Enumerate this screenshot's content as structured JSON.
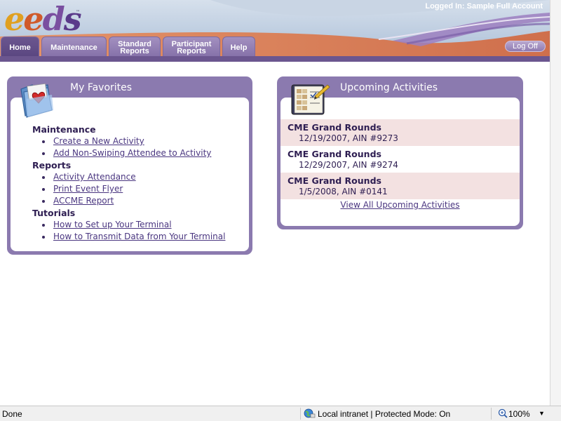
{
  "header": {
    "logo": {
      "part1": "e",
      "part2": "e",
      "part3": "d",
      "part4": "s",
      "trademark": "™"
    },
    "logged_in_text": "Logged In: Sample Full Account",
    "logoff_label": "Log Off"
  },
  "tabs": [
    {
      "line1": "Home",
      "line2": "",
      "active": true
    },
    {
      "line1": "Maintenance",
      "line2": "",
      "active": false
    },
    {
      "line1": "Standard",
      "line2": "Reports",
      "active": false
    },
    {
      "line1": "Participant",
      "line2": "Reports",
      "active": false
    },
    {
      "line1": "Help",
      "line2": "",
      "active": false
    }
  ],
  "favorites": {
    "title": "My Favorites",
    "icon": "folder-heart-icon",
    "sections": [
      {
        "heading": "Maintenance",
        "links": [
          "Create a New Activity",
          "Add Non-Swiping Attendee to Activity"
        ]
      },
      {
        "heading": "Reports",
        "links": [
          "Activity Attendance",
          "Print Event Flyer",
          "ACCME Report"
        ]
      },
      {
        "heading": "Tutorials",
        "links": [
          "How to Set up Your Terminal",
          "How to Transmit Data from Your Terminal"
        ]
      }
    ]
  },
  "upcoming": {
    "title": "Upcoming Activities",
    "icon": "checklist-notebook-icon",
    "activities": [
      {
        "title": "CME Grand Rounds",
        "detail": "12/19/2007, AIN #9273"
      },
      {
        "title": "CME Grand Rounds",
        "detail": "12/29/2007, AIN #9274"
      },
      {
        "title": "CME Grand Rounds",
        "detail": "1/5/2008, AIN #0141"
      }
    ],
    "view_all_label": "View All Upcoming Activities"
  },
  "statusbar": {
    "status": "Done",
    "zone": "Local intranet | Protected Mode: On",
    "zoom": "100%",
    "zoom_arrow": "▼"
  },
  "colors": {
    "panel_purple": "#8b7aaf",
    "tab_active": "#6b568f",
    "row_shade": "#f3e1e1",
    "header_orange": "#d9825a"
  }
}
